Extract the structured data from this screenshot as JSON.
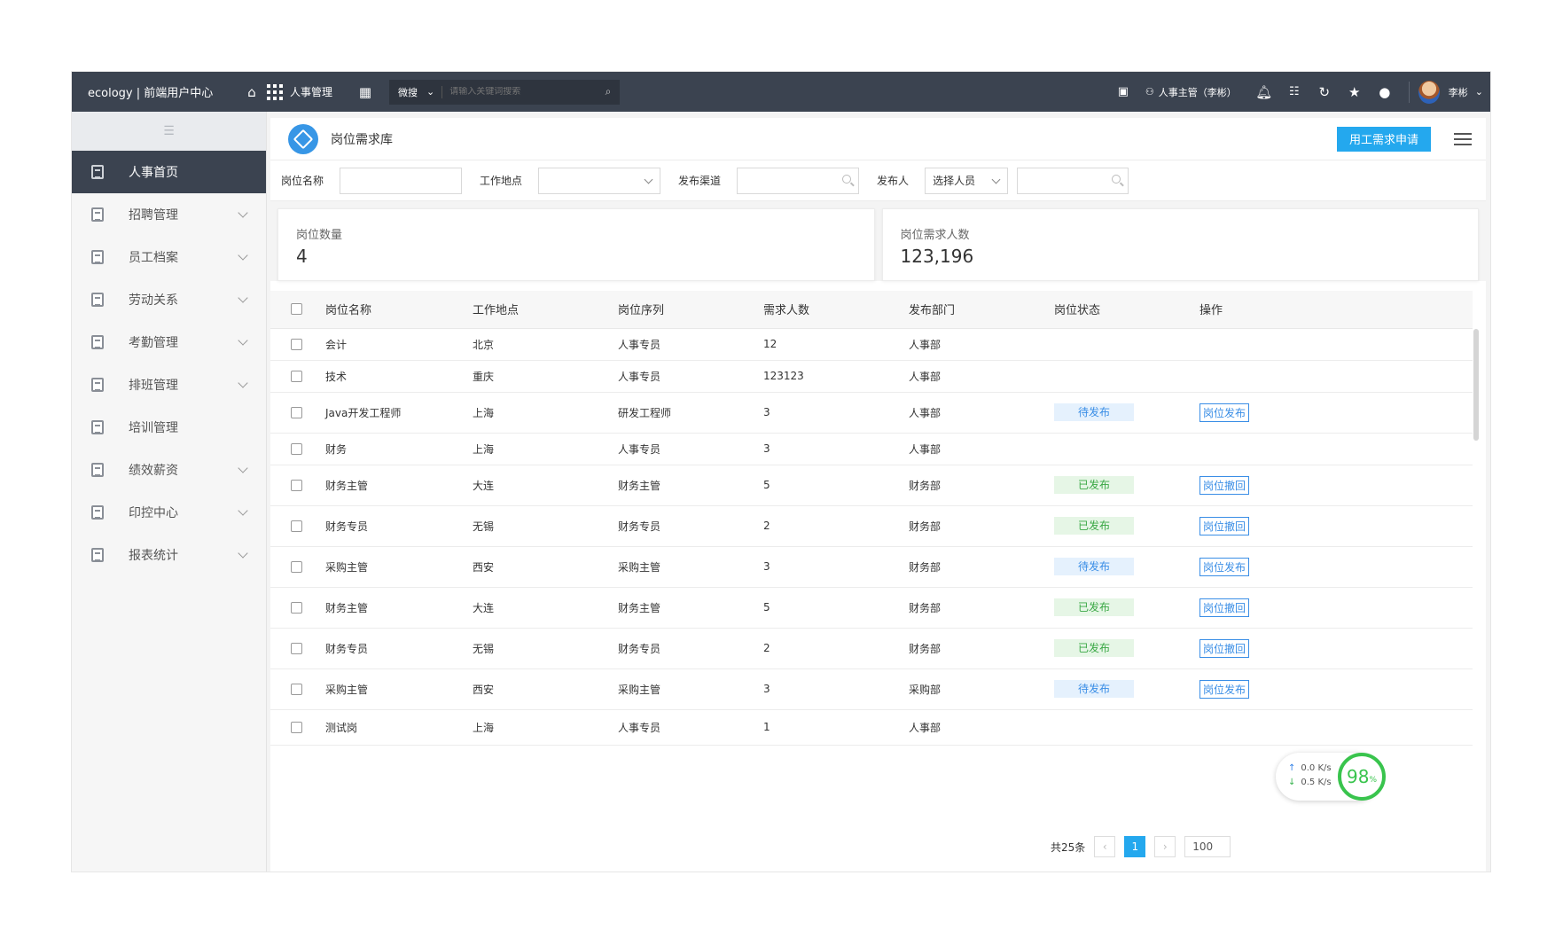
{
  "topbar": {
    "brand": "ecology | 前端用户中心",
    "module": "人事管理",
    "search_type": "微搜",
    "search_placeholder": "请输入关键词搜索",
    "user_role": "人事主管（李彬）",
    "user_name": "李彬"
  },
  "sidebar": {
    "items": [
      {
        "label": "人事首页",
        "active": true,
        "expandable": false
      },
      {
        "label": "招聘管理",
        "active": false,
        "expandable": true
      },
      {
        "label": "员工档案",
        "active": false,
        "expandable": true
      },
      {
        "label": "劳动关系",
        "active": false,
        "expandable": true
      },
      {
        "label": "考勤管理",
        "active": false,
        "expandable": true
      },
      {
        "label": "排班管理",
        "active": false,
        "expandable": true
      },
      {
        "label": "培训管理",
        "active": false,
        "expandable": false
      },
      {
        "label": "绩效薪资",
        "active": false,
        "expandable": true
      },
      {
        "label": "印控中心",
        "active": false,
        "expandable": true
      },
      {
        "label": "报表统计",
        "active": false,
        "expandable": true
      }
    ]
  },
  "page": {
    "title": "岗位需求库",
    "apply_button": "用工需求申请"
  },
  "filters": {
    "position_label": "岗位名称",
    "location_label": "工作地点",
    "channel_label": "发布渠道",
    "publisher_label": "发布人",
    "publisher_select": "选择人员"
  },
  "stats": {
    "count_label": "岗位数量",
    "count_value": "4",
    "demand_label": "岗位需求人数",
    "demand_value": "123,196"
  },
  "table": {
    "headers": [
      "岗位名称",
      "工作地点",
      "岗位序列",
      "需求人数",
      "发布部门",
      "岗位状态",
      "操作"
    ],
    "rows": [
      {
        "name": "会计",
        "location": "北京",
        "sequence": "人事专员",
        "count": "12",
        "dept": "人事部",
        "status": "",
        "status_type": "",
        "action": ""
      },
      {
        "name": "技术",
        "location": "重庆",
        "sequence": "人事专员",
        "count": "123123",
        "dept": "人事部",
        "status": "",
        "status_type": "",
        "action": ""
      },
      {
        "name": "Java开发工程师",
        "location": "上海",
        "sequence": "研发工程师",
        "count": "3",
        "dept": "人事部",
        "status": "待发布",
        "status_type": "pending",
        "action": "岗位发布"
      },
      {
        "name": "财务",
        "location": "上海",
        "sequence": "人事专员",
        "count": "3",
        "dept": "人事部",
        "status": "",
        "status_type": "",
        "action": ""
      },
      {
        "name": "财务主管",
        "location": "大连",
        "sequence": "财务主管",
        "count": "5",
        "dept": "财务部",
        "status": "已发布",
        "status_type": "published",
        "action": "岗位撤回"
      },
      {
        "name": "财务专员",
        "location": "无锡",
        "sequence": "财务专员",
        "count": "2",
        "dept": "财务部",
        "status": "已发布",
        "status_type": "published",
        "action": "岗位撤回"
      },
      {
        "name": "采购主管",
        "location": "西安",
        "sequence": "采购主管",
        "count": "3",
        "dept": "财务部",
        "status": "待发布",
        "status_type": "pending",
        "action": "岗位发布"
      },
      {
        "name": "财务主管",
        "location": "大连",
        "sequence": "财务主管",
        "count": "5",
        "dept": "财务部",
        "status": "已发布",
        "status_type": "published",
        "action": "岗位撤回"
      },
      {
        "name": "财务专员",
        "location": "无锡",
        "sequence": "财务专员",
        "count": "2",
        "dept": "财务部",
        "status": "已发布",
        "status_type": "published",
        "action": "岗位撤回"
      },
      {
        "name": "采购主管",
        "location": "西安",
        "sequence": "采购主管",
        "count": "3",
        "dept": "采购部",
        "status": "待发布",
        "status_type": "pending",
        "action": "岗位发布"
      },
      {
        "name": "测试岗",
        "location": "上海",
        "sequence": "人事专员",
        "count": "1",
        "dept": "人事部",
        "status": "",
        "status_type": "",
        "action": ""
      }
    ]
  },
  "pagination": {
    "total_text": "共25条",
    "current_page": "1",
    "page_size": "100"
  },
  "network_widget": {
    "upload": "0.0 K/s",
    "download": "0.5 K/s",
    "percent": "98",
    "percent_unit": "%"
  }
}
